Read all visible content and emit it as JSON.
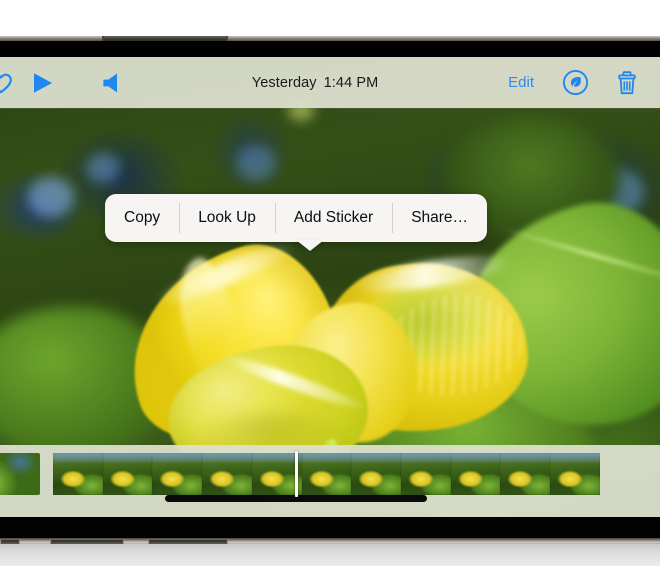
{
  "app": {
    "name": "Photos",
    "platform": "iOS",
    "orientation": "landscape"
  },
  "toolbar": {
    "favorite_icon": "heart-icon",
    "play_icon": "play-icon",
    "mute_icon": "speaker-mute-icon",
    "date_label": "Yesterday",
    "time_label": "1:44 PM",
    "edit_label": "Edit",
    "live_photo_icon": "leaf-in-circle-icon",
    "delete_icon": "trash-icon",
    "accent_color": "#1f87f0",
    "background_color": "#dde0cf"
  },
  "context_menu": {
    "visible": true,
    "items": [
      {
        "label": "Copy"
      },
      {
        "label": "Look Up"
      },
      {
        "label": "Add Sticker"
      },
      {
        "label": "Share…"
      }
    ],
    "background_color": "#f6f5f3",
    "caret_anchor_item": "Add Sticker"
  },
  "photo": {
    "subject": "yellow pea flower",
    "background": "green foliage bokeh"
  },
  "scrubber": {
    "previous_thumbnail_visible": true,
    "frame_count": 11,
    "playhead_visible": true,
    "background_color": "#dbdfcd"
  },
  "home_indicator": {
    "visible": true
  }
}
